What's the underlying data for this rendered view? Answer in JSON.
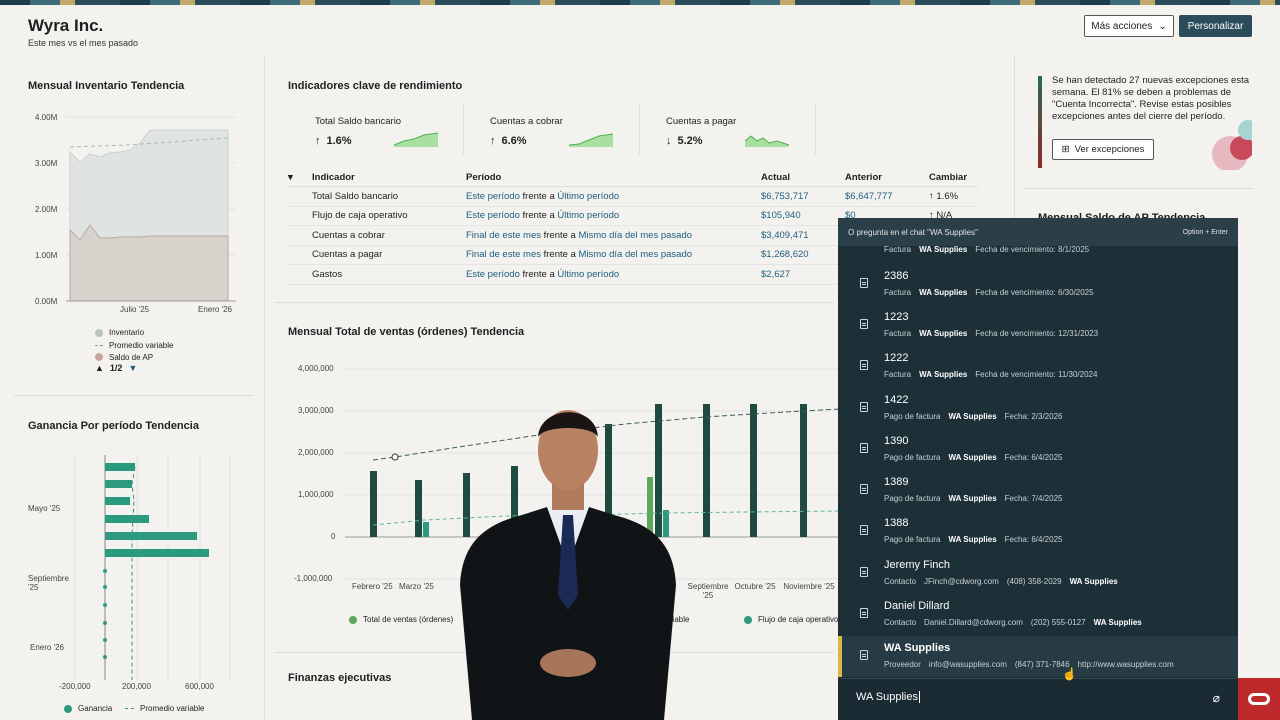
{
  "header": {
    "title": "Wyra Inc.",
    "subtitle": "Este mes vs el mes pasado",
    "more_actions": "Más acciones",
    "personalize": "Personalizar"
  },
  "inventory_card": {
    "title": "Mensual Inventario Tendencia",
    "yticks": [
      "4.00M",
      "3.00M",
      "2.00M",
      "1.00M",
      "0.00M"
    ],
    "xticks": [
      "Julio '25",
      "Enero '26"
    ],
    "legend": [
      "Inventario",
      "Promedio variable",
      "Saldo de AP"
    ],
    "pager": "1/2"
  },
  "profit_card": {
    "title": "Ganancia Por período Tendencia",
    "ycats": [
      "Mayo '25",
      "Septiembre '25",
      "Enero '26"
    ],
    "xticks": [
      "-200,000",
      "200,000",
      "600,000"
    ],
    "legend": [
      "Ganancia",
      "Promedio variable"
    ]
  },
  "kpi_card": {
    "title": "Indicadores clave de rendimiento",
    "tiles": [
      {
        "name": "Total Saldo bancario",
        "value": "1.6%",
        "dir": "up"
      },
      {
        "name": "Cuentas a cobrar",
        "value": "6.6%",
        "dir": "up"
      },
      {
        "name": "Cuentas a pagar",
        "value": "5.2%",
        "dir": "down"
      }
    ],
    "table": {
      "headers": [
        "Indicador",
        "Período",
        "Actual",
        "Anterior",
        "Cambiar"
      ],
      "rows": [
        {
          "name": "Total Saldo bancario",
          "p1": "Este período",
          "mid": "frente a",
          "p2": "Último período",
          "actual": "$6,753,717",
          "prev": "$6,647,777",
          "change": "1.6%"
        },
        {
          "name": "Flujo de caja operativo",
          "p1": "Este período",
          "mid": "frente a",
          "p2": "Último período",
          "actual": "$105,940",
          "prev": "$0",
          "change": "N/A"
        },
        {
          "name": "Cuentas a cobrar",
          "p1": "Final de este mes",
          "mid": "frente a",
          "p2": "Mismo día del mes pasado",
          "actual": "$3,409,471",
          "prev": "",
          "change": ""
        },
        {
          "name": "Cuentas a pagar",
          "p1": "Final de este mes",
          "mid": "frente a",
          "p2": "Mismo día del mes pasado",
          "actual": "$1,268,620",
          "prev": "",
          "change": ""
        },
        {
          "name": "Gastos",
          "p1": "Este período",
          "mid": "frente a",
          "p2": "Último período",
          "actual": "$2,627",
          "prev": "",
          "change": ""
        }
      ]
    }
  },
  "sales_card": {
    "title": "Mensual Total de ventas (órdenes) Tendencia",
    "yticks": [
      "4,000,000",
      "3,000,000",
      "2,000,000",
      "1,000,000",
      "0",
      "-1,000,000"
    ],
    "xticks": [
      "Febrero '25",
      "Marzo '25",
      "Septiembre '25",
      "Octubre '25",
      "Noviembre '25"
    ],
    "legend": [
      "Total de ventas (órdenes)",
      "Promedio variable",
      "Flujo de caja operativo"
    ]
  },
  "exec_card": {
    "title": "Finanzas ejecutivas"
  },
  "exceptions": {
    "text": "Se han detectado 27 nuevas excepciones esta semana. El 81% se deben a problemas de \"Cuenta Incorrecta\". Revise estas posibles excepciones antes del cierre del período.",
    "button": "Ver excepciones"
  },
  "ap_card": {
    "title": "Mensual Saldo de AP Tendencia"
  },
  "search_panel": {
    "header": "O pregunta en el chat \"WA Supplies\"",
    "shortcut": "Option + Enter",
    "partial": {
      "type": "Factura",
      "vendor": "WA Supplies",
      "due": "Fecha de vencimiento: 8/1/2025"
    },
    "results": [
      {
        "title": "2386",
        "type": "Factura",
        "vendor": "WA Supplies",
        "detail": "Fecha de vencimiento: 6/30/2025"
      },
      {
        "title": "1223",
        "type": "Factura",
        "vendor": "WA Supplies",
        "detail": "Fecha de vencimiento: 12/31/2023"
      },
      {
        "title": "1222",
        "type": "Factura",
        "vendor": "WA Supplies",
        "detail": "Fecha de vencimiento: 11/30/2024"
      },
      {
        "title": "1422",
        "type": "Pago de factura",
        "vendor": "WA Supplies",
        "detail": "Fecha: 2/3/2026"
      },
      {
        "title": "1390",
        "type": "Pago de factura",
        "vendor": "WA Supplies",
        "detail": "Fecha: 6/4/2025"
      },
      {
        "title": "1389",
        "type": "Pago de factura",
        "vendor": "WA Supplies",
        "detail": "Fecha: 7/4/2025"
      },
      {
        "title": "1388",
        "type": "Pago de factura",
        "vendor": "WA Supplies",
        "detail": "Fecha: 6/4/2025"
      },
      {
        "title": "Jeremy Finch",
        "type": "Contacto",
        "email": "JFinch@cdworg.com",
        "phone": "(408) 358-2029",
        "vendor": "WA Supplies"
      },
      {
        "title": "Daniel Dillard",
        "type": "Contacto",
        "email": "Daniel.Dillard@cdworg.com",
        "phone": "(202) 555-0127",
        "vendor": "WA Supplies"
      },
      {
        "title": "WA Supplies",
        "type": "Proveedor",
        "email": "info@wasupplies.com",
        "phone": "(847) 371-7846",
        "url": "http://www.wasupplies.com"
      }
    ],
    "input_value": "WA Supplies"
  },
  "colors": {
    "brand": "#2b4c59",
    "bar": "#1f5a4a",
    "accent": "#d9b84a",
    "panel": "#1d3038"
  },
  "icons": [
    "chevron-down-icon",
    "arrow-up-icon",
    "arrow-down-icon",
    "document-icon",
    "attach-icon",
    "oracle-logo-icon",
    "exceptions-icon"
  ]
}
